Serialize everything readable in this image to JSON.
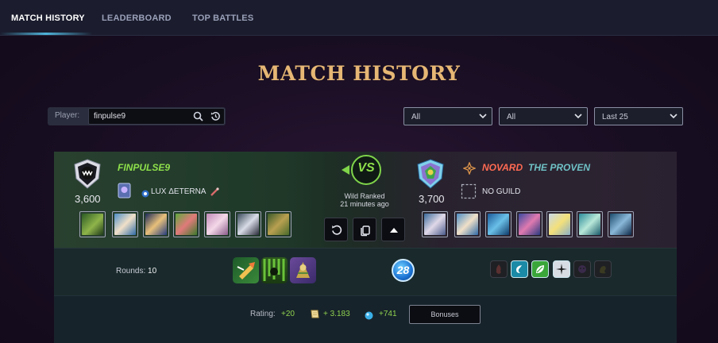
{
  "nav": {
    "tabs": [
      {
        "label": "MATCH HISTORY",
        "active": true
      },
      {
        "label": "LEADERBOARD",
        "active": false
      },
      {
        "label": "TOP BATTLES",
        "active": false
      }
    ]
  },
  "page_title": "MATCH HISTORY",
  "search": {
    "label": "Player:",
    "value": "finpulse9"
  },
  "filters": [
    {
      "selected": "All"
    },
    {
      "selected": "All"
    },
    {
      "selected": "Last 25"
    }
  ],
  "match": {
    "player": {
      "name": "FINPULSE9",
      "rating": "3,600",
      "guild": "LUX ΔETERNA",
      "team_card_count": 7
    },
    "opponent": {
      "name": "NOVARD",
      "title": "THE PROVEN",
      "rating": "3,700",
      "guild": "NO GUILD",
      "team_card_count": 7
    },
    "vs_label": "VS",
    "format": "Wild Ranked",
    "time_ago": "21 minutes ago",
    "rounds_label": "Rounds:",
    "rounds_value": "10",
    "mana_cap": "28",
    "rulesets": [
      "ruleset-1-icon",
      "ruleset-2-icon",
      "ruleset-3-icon"
    ],
    "splinters": [
      {
        "name": "fire",
        "enabled": false
      },
      {
        "name": "water",
        "enabled": true
      },
      {
        "name": "earth",
        "enabled": true
      },
      {
        "name": "life",
        "enabled": true
      },
      {
        "name": "death",
        "enabled": false
      },
      {
        "name": "dragon",
        "enabled": false
      }
    ],
    "rewards": {
      "rating_label": "Rating:",
      "rating_change": "+20",
      "sps_change": "+ 3.183",
      "energy_change": "+741",
      "bonuses_label": "Bonuses"
    }
  },
  "colors": {
    "title_gold": "#e6b774",
    "winner_green": "#8ee04b",
    "opponent_red": "#ff6a52",
    "opponent_title_teal": "#6fc2c6",
    "accent_blue": "#4fb3d9"
  }
}
